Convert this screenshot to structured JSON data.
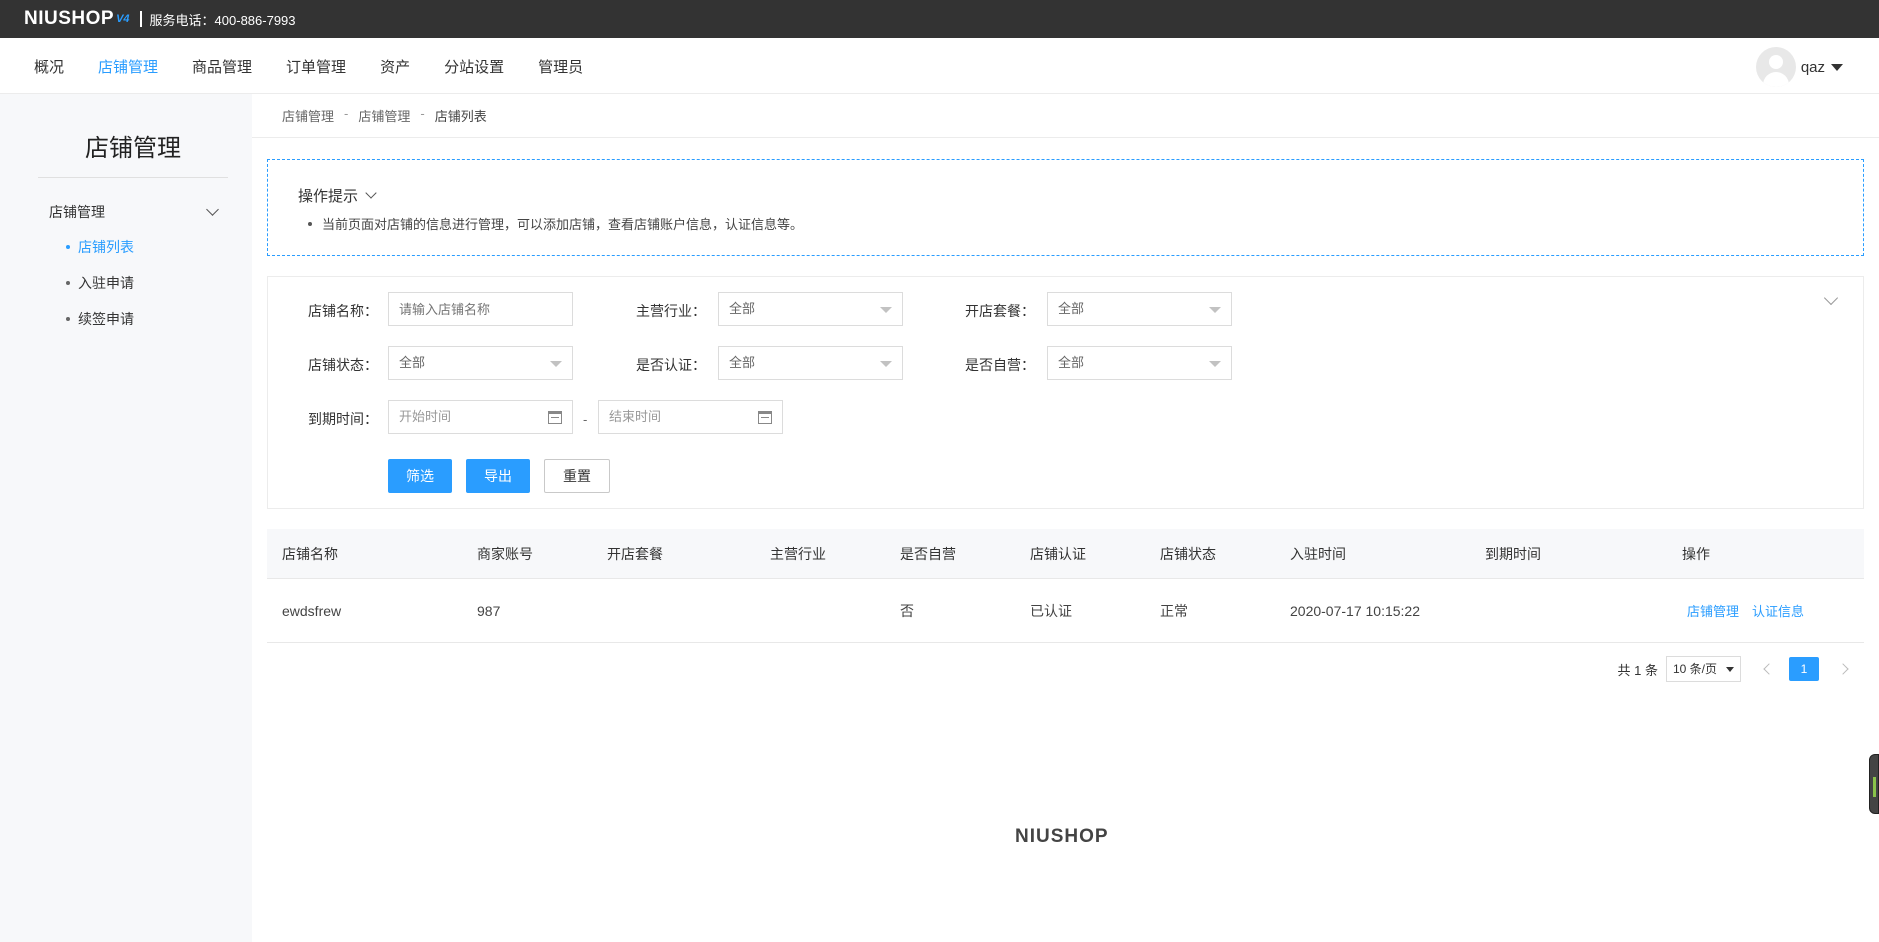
{
  "topbar": {
    "logo": "NIUSHOP",
    "logo_version": "V4",
    "phone": "服务电话：400-886-7993"
  },
  "nav": {
    "items": [
      {
        "label": "概况"
      },
      {
        "label": "店铺管理",
        "active": true
      },
      {
        "label": "商品管理"
      },
      {
        "label": "订单管理"
      },
      {
        "label": "资产"
      },
      {
        "label": "分站设置"
      },
      {
        "label": "管理员"
      }
    ],
    "user_name": "qaz"
  },
  "sidebar": {
    "title": "店铺管理",
    "group_label": "店铺管理",
    "items": [
      {
        "label": "店铺列表",
        "active": true
      },
      {
        "label": "入驻申请"
      },
      {
        "label": "续签申请"
      }
    ]
  },
  "breadcrumb": [
    "店铺管理",
    "店铺管理",
    "店铺列表"
  ],
  "breadcrumb_sep": "-",
  "tips": {
    "title": "操作提示",
    "text": "当前页面对店铺的信息进行管理，可以添加店铺，查看店铺账户信息，认证信息等。"
  },
  "filter": {
    "store_name_label": "店铺名称：",
    "store_name_placeholder": "请输入店铺名称",
    "industry_label": "主营行业：",
    "industry_value": "全部",
    "package_label": "开店套餐：",
    "package_value": "全部",
    "status_label": "店铺状态：",
    "status_value": "全部",
    "certified_label": "是否认证：",
    "certified_value": "全部",
    "self_run_label": "是否自营：",
    "self_run_value": "全部",
    "expire_label": "到期时间：",
    "start_placeholder": "开始时间",
    "date_sep": "-",
    "end_placeholder": "结束时间",
    "btn_filter": "筛选",
    "btn_export": "导出",
    "btn_reset": "重置"
  },
  "table": {
    "headers": [
      "店铺名称",
      "商家账号",
      "开店套餐",
      "主营行业",
      "是否自营",
      "店铺认证",
      "店铺状态",
      "入驻时间",
      "到期时间",
      "操作"
    ],
    "rows": [
      {
        "store_name": "ewdsfrew",
        "account": "987",
        "package": "",
        "industry": "",
        "self_run": "否",
        "certified": "已认证",
        "status": "正常",
        "join_time": "2020-07-17 10:15:22",
        "expire_time": "",
        "op_manage": "店铺管理",
        "op_cert": "认证信息"
      }
    ]
  },
  "pager": {
    "total": "共 1 条",
    "page_size": "10 条/页",
    "current": "1"
  },
  "footer": {
    "logo": "NIUSHOP"
  },
  "colors": {
    "accent": "#2a9dff",
    "topbar": "#333333",
    "certified": "#1a8a1a"
  }
}
